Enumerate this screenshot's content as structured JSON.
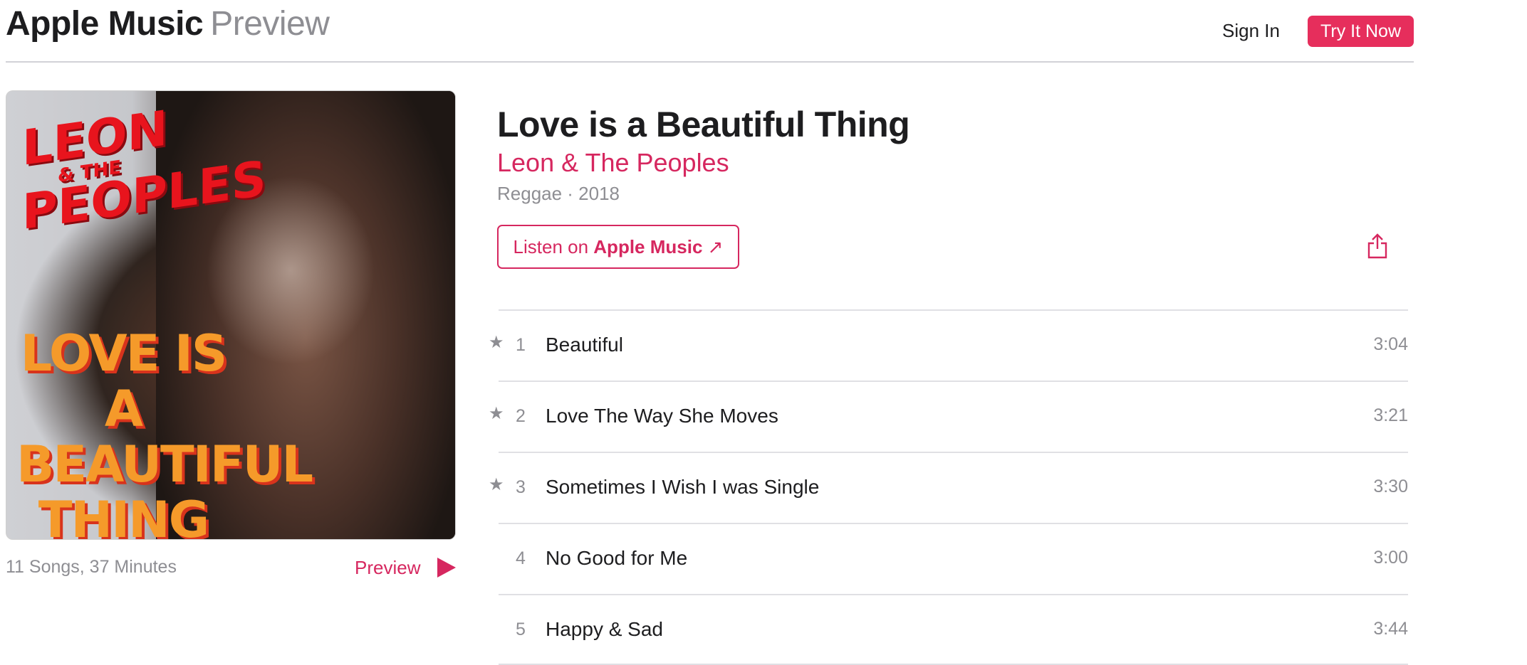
{
  "header": {
    "brand_primary": "Apple Music",
    "brand_secondary": "Preview",
    "sign_in": "Sign In",
    "try_it_now": "Try It Now"
  },
  "album": {
    "title": "Love is a Beautiful Thing",
    "artist": "Leon & The Peoples",
    "genre_year": "Reggae · 2018",
    "listen_prefix": "Listen on ",
    "listen_brand": "Apple Music",
    "listen_arrow": "↗",
    "summary": "11 Songs, 37 Minutes",
    "preview": "Preview",
    "artwork_band_line1": "LEON",
    "artwork_band_amp": "& THE",
    "artwork_band_line2": "PEOPLES",
    "artwork_title": "LOVE IS A BEAUTIFUL THING"
  },
  "tracks": [
    {
      "popular": true,
      "num": "1",
      "name": "Beautiful",
      "duration": "3:04"
    },
    {
      "popular": true,
      "num": "2",
      "name": "Love The Way She Moves",
      "duration": "3:21"
    },
    {
      "popular": true,
      "num": "3",
      "name": "Sometimes I Wish I was Single",
      "duration": "3:30"
    },
    {
      "popular": false,
      "num": "4",
      "name": "No Good for Me",
      "duration": "3:00"
    },
    {
      "popular": false,
      "num": "5",
      "name": "Happy & Sad",
      "duration": "3:44"
    }
  ],
  "icons": {
    "star": "★",
    "play": "play-icon",
    "share": "share-icon"
  },
  "colors": {
    "accent": "#d6275f",
    "button": "#e62e5c",
    "muted": "#8e8e93"
  }
}
